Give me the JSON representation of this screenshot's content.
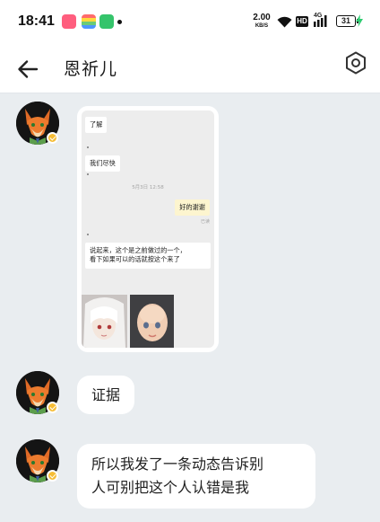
{
  "status_bar": {
    "time": "18:41",
    "net_speed_value": "2.00",
    "net_speed_unit": "KB/S",
    "hd_label": "HD",
    "network_label": "4G",
    "battery_level": "31",
    "app_icons": [
      "red-app-icon",
      "rainbow-app-icon",
      "green-app-icon"
    ]
  },
  "header": {
    "title": "恩祈儿",
    "back_icon": "arrow-left-icon",
    "settings_icon": "hexagon-settings-icon"
  },
  "messages": {
    "image": {
      "inner": {
        "msg1": "了解",
        "msg2": "我们尽快",
        "time": "5月3日 12:58",
        "msg3": "好的谢谢",
        "read": "已读",
        "msg4_line1": "说起来，这个是之前做过的一个，",
        "msg4_line2": "看下如果可以的话就按这个来了"
      }
    },
    "text1": "证据",
    "text2_line1": "所以我发了一条动态告诉别",
    "text2_line2": "人可别把这个人认错是我"
  },
  "colors": {
    "background": "#e9edf0",
    "bar": "#ffffff",
    "bubble": "#ffffff",
    "badge": "#f6bd35",
    "charging": "#2ecc71"
  }
}
